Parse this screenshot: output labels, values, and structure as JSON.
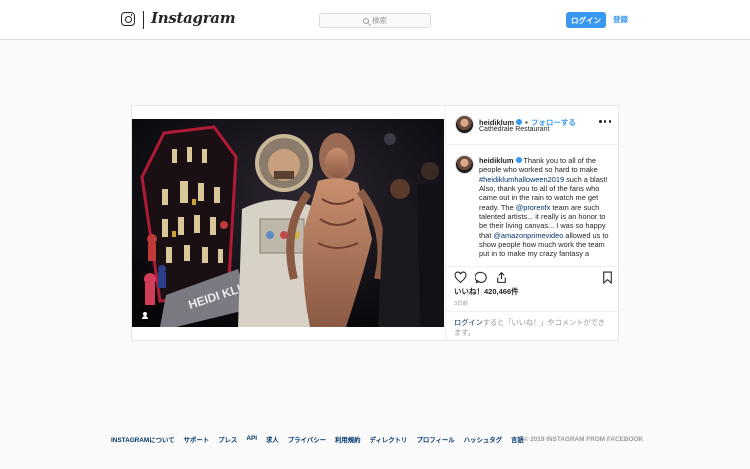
{
  "header": {
    "brand": "Instagram",
    "search_placeholder": "検索",
    "login_label": "ログイン",
    "signup_label": "登録"
  },
  "post": {
    "username": "heidiklum",
    "follow_separator": "•",
    "follow_label": "フォローする",
    "location": "Cathédrale Restaurant",
    "caption_intro": "Thank you to all of the people who worked so hard to make ",
    "caption_hashtag": "#heidiklumhalloween2019",
    "caption_mid": " such a blast! Also, thank you to all of the fans who came out in the rain to watch me get ready. The ",
    "caption_mention1": "@prorenfx",
    "caption_mid2": " team are such talented artists... it really is an honor to be their living canvas... I was so happy that ",
    "caption_mention2": "@amazonprimevideo",
    "caption_end": " allowed us to show people how much work the team put in to make my crazy fantasy a",
    "likes": "いいね！420,466件",
    "time": "3日前",
    "prompt_login": "ログイン",
    "prompt_text": "すると「いいね！」やコメントができます。"
  },
  "footer": {
    "links": [
      "INSTAGRAMについて",
      "サポート",
      "プレス",
      "API",
      "求人",
      "プライバシー",
      "利用規約",
      "ディレクトリ",
      "プロフィール",
      "ハッシュタグ",
      "言語"
    ],
    "copyright": "© 2019 INSTAGRAM FROM FACEBOOK"
  },
  "colors": {
    "accent": "#3897f0",
    "link": "#003569",
    "border": "#dbdbdb",
    "background": "#fafafa"
  },
  "icons": [
    "instagram-glyph-icon",
    "search-icon",
    "verified-icon",
    "more-options-icon",
    "heart-icon",
    "comment-icon",
    "share-icon",
    "bookmark-icon",
    "user-tag-icon"
  ]
}
